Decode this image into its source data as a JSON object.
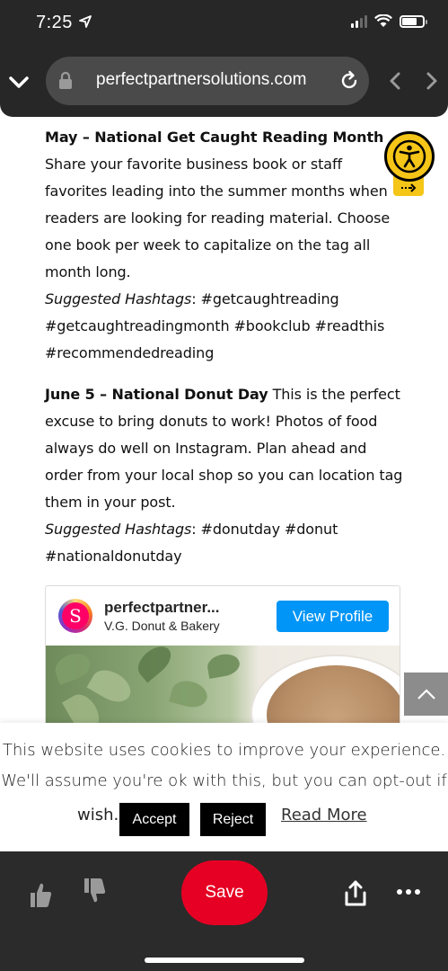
{
  "status_bar": {
    "time": "7:25"
  },
  "browser": {
    "url": "perfectpartnersolutions.com"
  },
  "article": {
    "may_title": "May – National Get Caught Reading Month",
    "may_body": " Share your favorite business book or staff favorites leading into the summer months when readers are looking for reading material. Choose one book per week to capitalize on the tag all month long.",
    "may_hashtag_label": "Suggested Hashtags",
    "may_hashtags": ": #getcaughtreading #getcaughtreadingmonth #bookclub #readthis #recommendedreading",
    "june_title": "June 5 – National Donut Day",
    "june_body": " This is the perfect excuse to bring donuts to work! Photos of food always do well on Instagram. Plan ahead and order from your local shop so you can location tag them in your post.",
    "june_hashtag_label": "Suggested Hashtags",
    "june_hashtags": ": #donutday #donut #nationaldonutday"
  },
  "instagram_embed": {
    "username": "perfectpartner...",
    "location": "V.G. Donut & Bakery",
    "view_profile_label": "View Profile",
    "avatar_letter": "S"
  },
  "cookie_banner": {
    "message": "This website uses cookies to improve your experience. We'll assume you're ok with this, but you can opt-out if you",
    "wish_text": "wish.",
    "accept_label": "Accept",
    "reject_label": "Reject",
    "read_more_label": "Read More"
  },
  "bottom_bar": {
    "save_label": "Save"
  },
  "colors": {
    "save_red": "#e60023",
    "instagram_blue": "#0095f6",
    "a11y_yellow": "#f5c518"
  }
}
